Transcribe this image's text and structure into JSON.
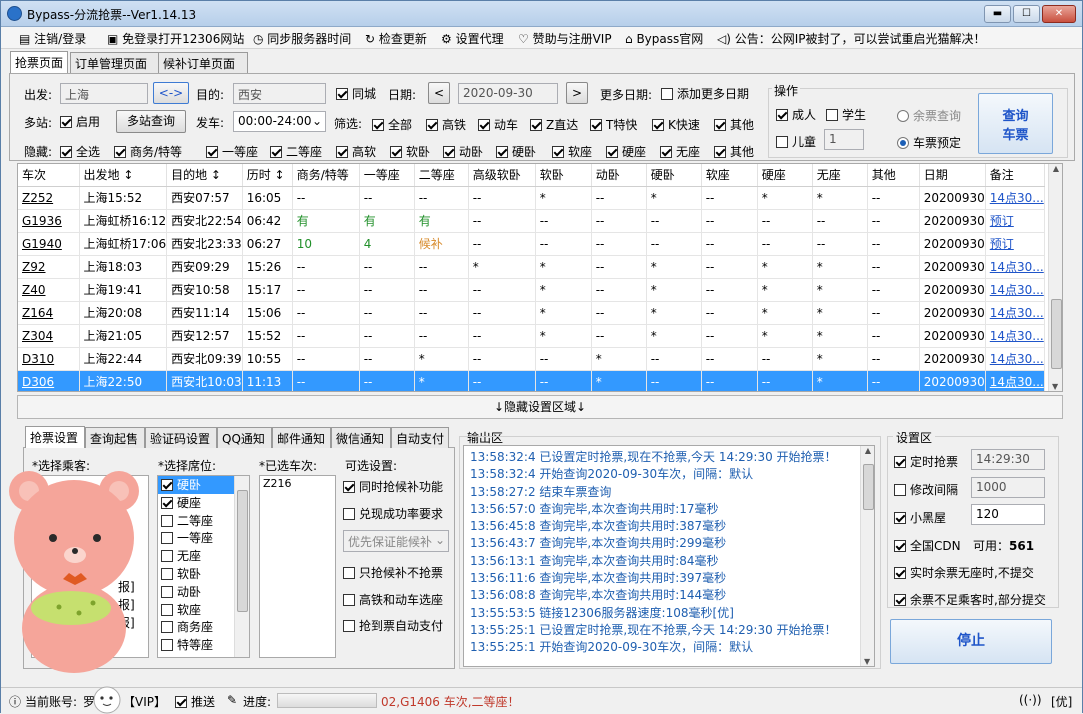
{
  "window": {
    "title": "Bypass-分流抢票--Ver1.14.13",
    "btn_min": "▬",
    "btn_max": "☐",
    "btn_close": "✕"
  },
  "menu": [
    {
      "label": "注销/登录",
      "icon": "logout-icon"
    },
    {
      "label": "免登录打开12306网站",
      "icon": "window-icon"
    },
    {
      "label": "同步服务器时间",
      "icon": "clock-icon"
    },
    {
      "label": "检查更新",
      "icon": "refresh-icon"
    },
    {
      "label": "设置代理",
      "icon": "gear-icon"
    },
    {
      "label": "赞助与注册VIP",
      "icon": "heart-icon"
    },
    {
      "label": "Bypass官网",
      "icon": "home-icon"
    },
    {
      "label": "公告：公网IP被封了，可以尝试重启光猫解决！",
      "icon": "speaker-icon"
    }
  ],
  "main_tabs": [
    "抢票页面",
    "订单管理页面",
    "候补订单页面"
  ],
  "query": {
    "from_label": "出发:",
    "from_value": "上海",
    "swap_label": "<->",
    "to_label": "目的:",
    "to_value": "西安",
    "same_city": "同城",
    "date_label": "日期:",
    "date_value": "2020-09-30",
    "prev": "<",
    "next": ">",
    "more_dates_label": "更多日期:",
    "add_dates": "添加更多日期",
    "multi_label": "多站:",
    "multi_enable": "启用",
    "multi_query_btn": "多站查询",
    "depart_label": "发车:",
    "depart_value": "00:00-24:00",
    "filter_label": "筛选:",
    "filters": [
      "全部",
      "高铁",
      "动车",
      "Z直达",
      "T特快",
      "K快速",
      "其他"
    ],
    "hide_label": "隐藏:",
    "hides": [
      "全选",
      "商务/特等",
      "一等座",
      "二等座",
      "高软",
      "软卧",
      "动卧",
      "硬卧",
      "软座",
      "硬座",
      "无座",
      "其他"
    ]
  },
  "ops": {
    "title": "操作",
    "adult": "成人",
    "student": "学生",
    "child": "儿童",
    "child_count": "1",
    "remain_query": "余票查询",
    "remain_book": "车票预定",
    "query_btn_line1": "查询",
    "query_btn_line2": "车票"
  },
  "grid": {
    "headers": [
      "车次",
      "出发地 ↕",
      "目的地 ↕",
      "历时 ↕",
      "商务/特等",
      "一等座",
      "二等座",
      "高级软卧",
      "软卧",
      "动卧",
      "硬卧",
      "软座",
      "硬座",
      "无座",
      "其他",
      "日期",
      "备注"
    ],
    "rows": [
      [
        "Z252",
        "上海15:52",
        "西安07:57",
        "16:05",
        "--",
        "--",
        "--",
        "--",
        "*",
        "--",
        "*",
        "--",
        "*",
        "*",
        "--",
        "20200930",
        "14点30..."
      ],
      [
        "G1936",
        "上海虹桥16:12",
        "西安北22:54",
        "06:42",
        "有",
        "有",
        "有",
        "--",
        "--",
        "--",
        "--",
        "--",
        "--",
        "--",
        "--",
        "20200930",
        "预订"
      ],
      [
        "G1940",
        "上海虹桥17:06",
        "西安北23:33",
        "06:27",
        "10",
        "4",
        "候补",
        "--",
        "--",
        "--",
        "--",
        "--",
        "--",
        "--",
        "--",
        "20200930",
        "预订"
      ],
      [
        "Z92",
        "上海18:03",
        "西安09:29",
        "15:26",
        "--",
        "--",
        "--",
        "*",
        "*",
        "--",
        "*",
        "--",
        "*",
        "*",
        "--",
        "20200930",
        "14点30..."
      ],
      [
        "Z40",
        "上海19:41",
        "西安10:58",
        "15:17",
        "--",
        "--",
        "--",
        "--",
        "*",
        "--",
        "*",
        "--",
        "*",
        "*",
        "--",
        "20200930",
        "14点30..."
      ],
      [
        "Z164",
        "上海20:08",
        "西安11:14",
        "15:06",
        "--",
        "--",
        "--",
        "--",
        "*",
        "--",
        "*",
        "--",
        "*",
        "*",
        "--",
        "20200930",
        "14点30..."
      ],
      [
        "Z304",
        "上海21:05",
        "西安12:57",
        "15:52",
        "--",
        "--",
        "--",
        "--",
        "*",
        "--",
        "*",
        "--",
        "*",
        "*",
        "--",
        "20200930",
        "14点30..."
      ],
      [
        "D310",
        "上海22:44",
        "西安北09:39",
        "10:55",
        "--",
        "--",
        "*",
        "--",
        "--",
        "*",
        "--",
        "--",
        "--",
        "*",
        "--",
        "20200930",
        "14点30..."
      ],
      [
        "D306",
        "上海22:50",
        "西安北10:03",
        "11:13",
        "--",
        "--",
        "*",
        "--",
        "--",
        "*",
        "--",
        "--",
        "--",
        "*",
        "--",
        "20200930",
        "14点30..."
      ]
    ],
    "selected_row": 8
  },
  "hide_settings_bar": "↓隐藏设置区域↓",
  "bottom_tabs": [
    "抢票设置",
    "查询起售",
    "验证码设置",
    "QQ通知",
    "邮件通知",
    "微信通知",
    "自动支付"
  ],
  "settings": {
    "passenger_label": "*选择乘客:",
    "passengers_partial": [
      "报]",
      "报]",
      "报]"
    ],
    "seat_label": "*选择席位:",
    "seats": [
      {
        "name": "硬卧",
        "checked": true,
        "selected": true
      },
      {
        "name": "硬座",
        "checked": true
      },
      {
        "name": "二等座"
      },
      {
        "name": "一等座"
      },
      {
        "name": "无座"
      },
      {
        "name": "软卧"
      },
      {
        "name": "动卧"
      },
      {
        "name": "软座"
      },
      {
        "name": "商务座"
      },
      {
        "name": "特等座"
      }
    ],
    "chosen_label": "*已选车次:",
    "chosen_value": "Z216",
    "options_label": "可选设置:",
    "opt_alternate": "同时抢候补功能",
    "opt_rate": "兑现成功率要求",
    "opt_priority": "优先保证能候补",
    "opt_only_alt": "只抢候补不抢票",
    "opt_hsr": "高铁和动车选座",
    "opt_autopay": "抢到票自动支付"
  },
  "output": {
    "title": "输出区",
    "lines": [
      "13:58:32:4  已设置定时抢票,现在不抢票,今天 14:29:30 开始抢票！",
      "13:58:32:4  开始查询2020-09-30车次，间隔：默认",
      "13:58:27:2  结束车票查询",
      "13:56:57:0  查询完毕,本次查询共用时:17毫秒",
      "13:56:45:8  查询完毕,本次查询共用时:387毫秒",
      "13:56:43:7  查询完毕,本次查询共用时:299毫秒",
      "13:56:13:1  查询完毕,本次查询共用时:84毫秒",
      "13:56:11:6  查询完毕,本次查询共用时:397毫秒",
      "13:56:08:8  查询完毕,本次查询共用时:144毫秒",
      "13:55:53:5  链接12306服务器速度:108毫秒[优]",
      "13:55:25:1  已设置定时抢票,现在不抢票,今天 14:29:30 开始抢票！",
      "13:55:25:1  开始查询2020-09-30车次，间隔：默认"
    ]
  },
  "setzone": {
    "title": "设置区",
    "timed": "定时抢票",
    "timed_value": "14:29:30",
    "interval": "修改间隔",
    "interval_value": "1000",
    "blackroom": "小黑屋",
    "blackroom_value": "120",
    "cdn": "全国CDN",
    "cdn_avail_label": "可用：",
    "cdn_avail": "561",
    "no_submit": "实时余票无座时,不提交",
    "partial_submit": "余票不足乘客时,部分提交",
    "stop_btn": "停止"
  },
  "status": {
    "account_label": "当前账号:",
    "account_value": "罗",
    "vip": "【VIP】",
    "push": "推送",
    "progress_label": "进度:",
    "progress_text": "02,G1406 车次,二等座！",
    "net": "[优]"
  },
  "colors": {
    "accent": "#1f55c9",
    "green": "#21902a",
    "orange": "#d78a2a",
    "selected": "#3399ff",
    "log": "#1f5fb0"
  }
}
